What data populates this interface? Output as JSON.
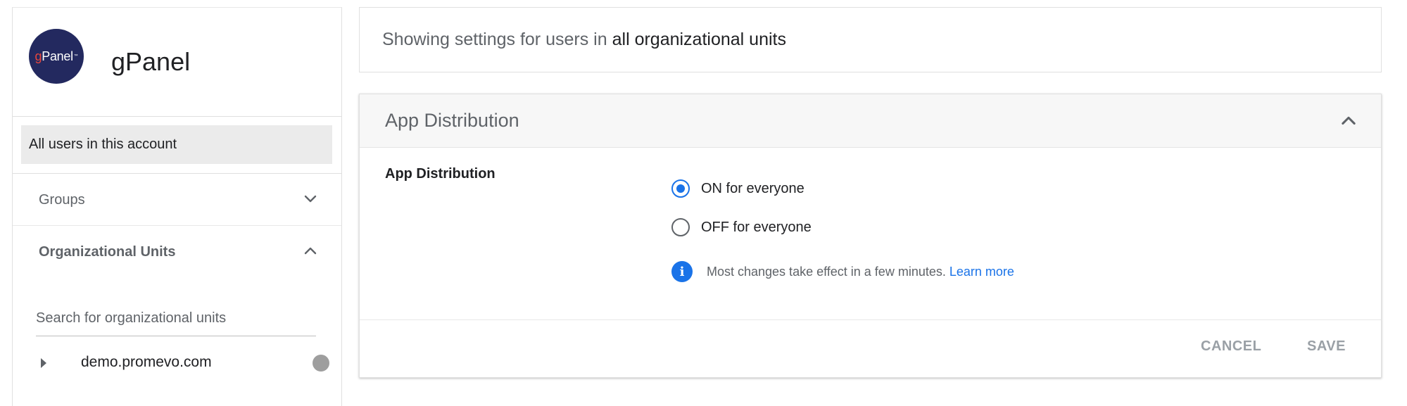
{
  "app": {
    "name": "gPanel",
    "logo_prefix": "g",
    "logo_rest": "Panel",
    "logo_tm": "™"
  },
  "sidebar": {
    "all_users_label": "All users in this account",
    "groups_label": "Groups",
    "org_units_label": "Organizational Units",
    "search": {
      "placeholder": "Search for organizational units",
      "value": ""
    },
    "tree": [
      {
        "label": "demo.promevo.com"
      }
    ]
  },
  "scope_banner": {
    "prefix": "Showing settings for users in",
    "scope": "all organizational units"
  },
  "card": {
    "title": "App Distribution",
    "setting_label": "App Distribution",
    "options": [
      {
        "label": "ON for everyone",
        "selected": true
      },
      {
        "label": "OFF for everyone",
        "selected": false
      }
    ],
    "info_text": "Most changes take effect in a few minutes.",
    "learn_more": "Learn more",
    "cancel_label": "CANCEL",
    "save_label": "SAVE"
  },
  "colors": {
    "accent": "#1a73e8",
    "logo_bg": "#23295f",
    "logo_g": "#e8463c",
    "selected_bg": "#ebebeb",
    "disabled_text": "#9aa0a6"
  },
  "icons": {
    "groups_toggle": "chevron-down-icon",
    "org_units_toggle": "chevron-up-icon",
    "card_collapse": "chevron-up-icon",
    "tree_expand": "caret-right-icon",
    "tree_status": "status-dot-icon",
    "info": "info-icon"
  }
}
